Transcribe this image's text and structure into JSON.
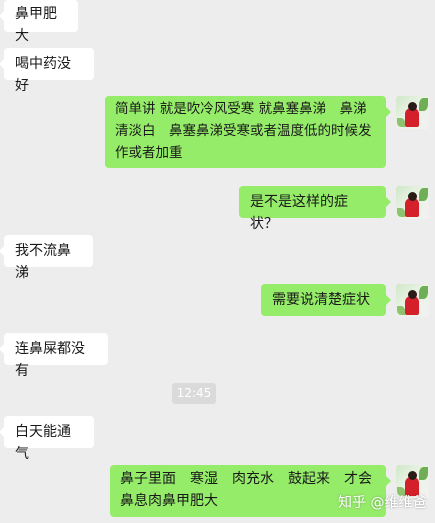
{
  "messages": [
    {
      "side": "left",
      "text": "鼻甲肥大"
    },
    {
      "side": "left",
      "text": "喝中药没好"
    },
    {
      "side": "right",
      "text": "简单讲 就是吹冷风受寒 就鼻塞鼻涕　鼻涕清淡白　鼻塞鼻涕受寒或者温度低的时候发作或者加重"
    },
    {
      "side": "right",
      "text": "是不是这样的症状？"
    },
    {
      "side": "left",
      "text": "我不流鼻涕"
    },
    {
      "side": "right",
      "text": "需要说清楚症状"
    },
    {
      "side": "left",
      "text": "连鼻屎都没有"
    },
    {
      "side": "left",
      "text": "白天能通气"
    },
    {
      "side": "right",
      "text": "鼻子里面　寒湿　肉充水　鼓起来　才会鼻息肉鼻甲肥大"
    }
  ],
  "timestamp": "12:45",
  "watermark": "知乎 @维维爸",
  "colors": {
    "background": "#ededed",
    "incoming_bubble": "#ffffff",
    "outgoing_bubble": "#95ec69",
    "timestamp_bg": "#dadada"
  }
}
